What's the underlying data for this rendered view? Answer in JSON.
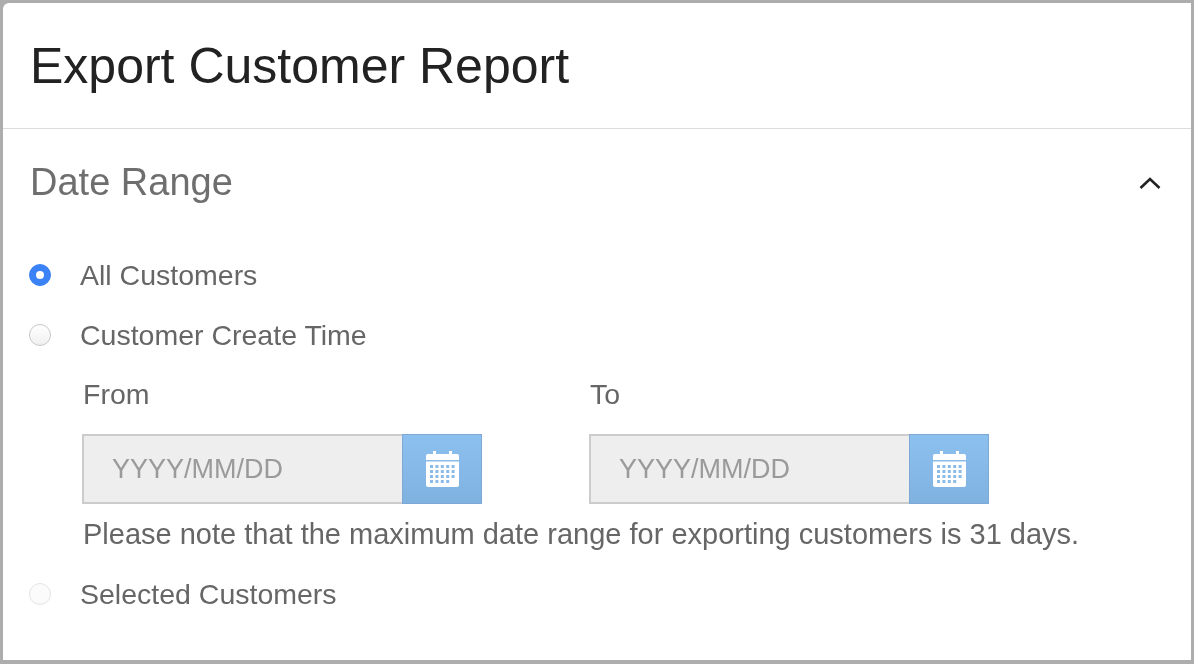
{
  "dialog": {
    "title": "Export Customer Report"
  },
  "section": {
    "title": "Date Range",
    "expanded": true
  },
  "options": [
    {
      "label": "All Customers",
      "selected": true,
      "disabled": false
    },
    {
      "label": "Customer Create Time",
      "selected": false,
      "disabled": false,
      "date_fields": [
        {
          "label": "From",
          "placeholder": "YYYY/MM/DD"
        },
        {
          "label": "To",
          "placeholder": "YYYY/MM/DD"
        }
      ],
      "note": "Please note that the maximum date range for exporting customers is 31 days."
    },
    {
      "label": "Selected Customers",
      "selected": false,
      "disabled": true
    }
  ]
}
